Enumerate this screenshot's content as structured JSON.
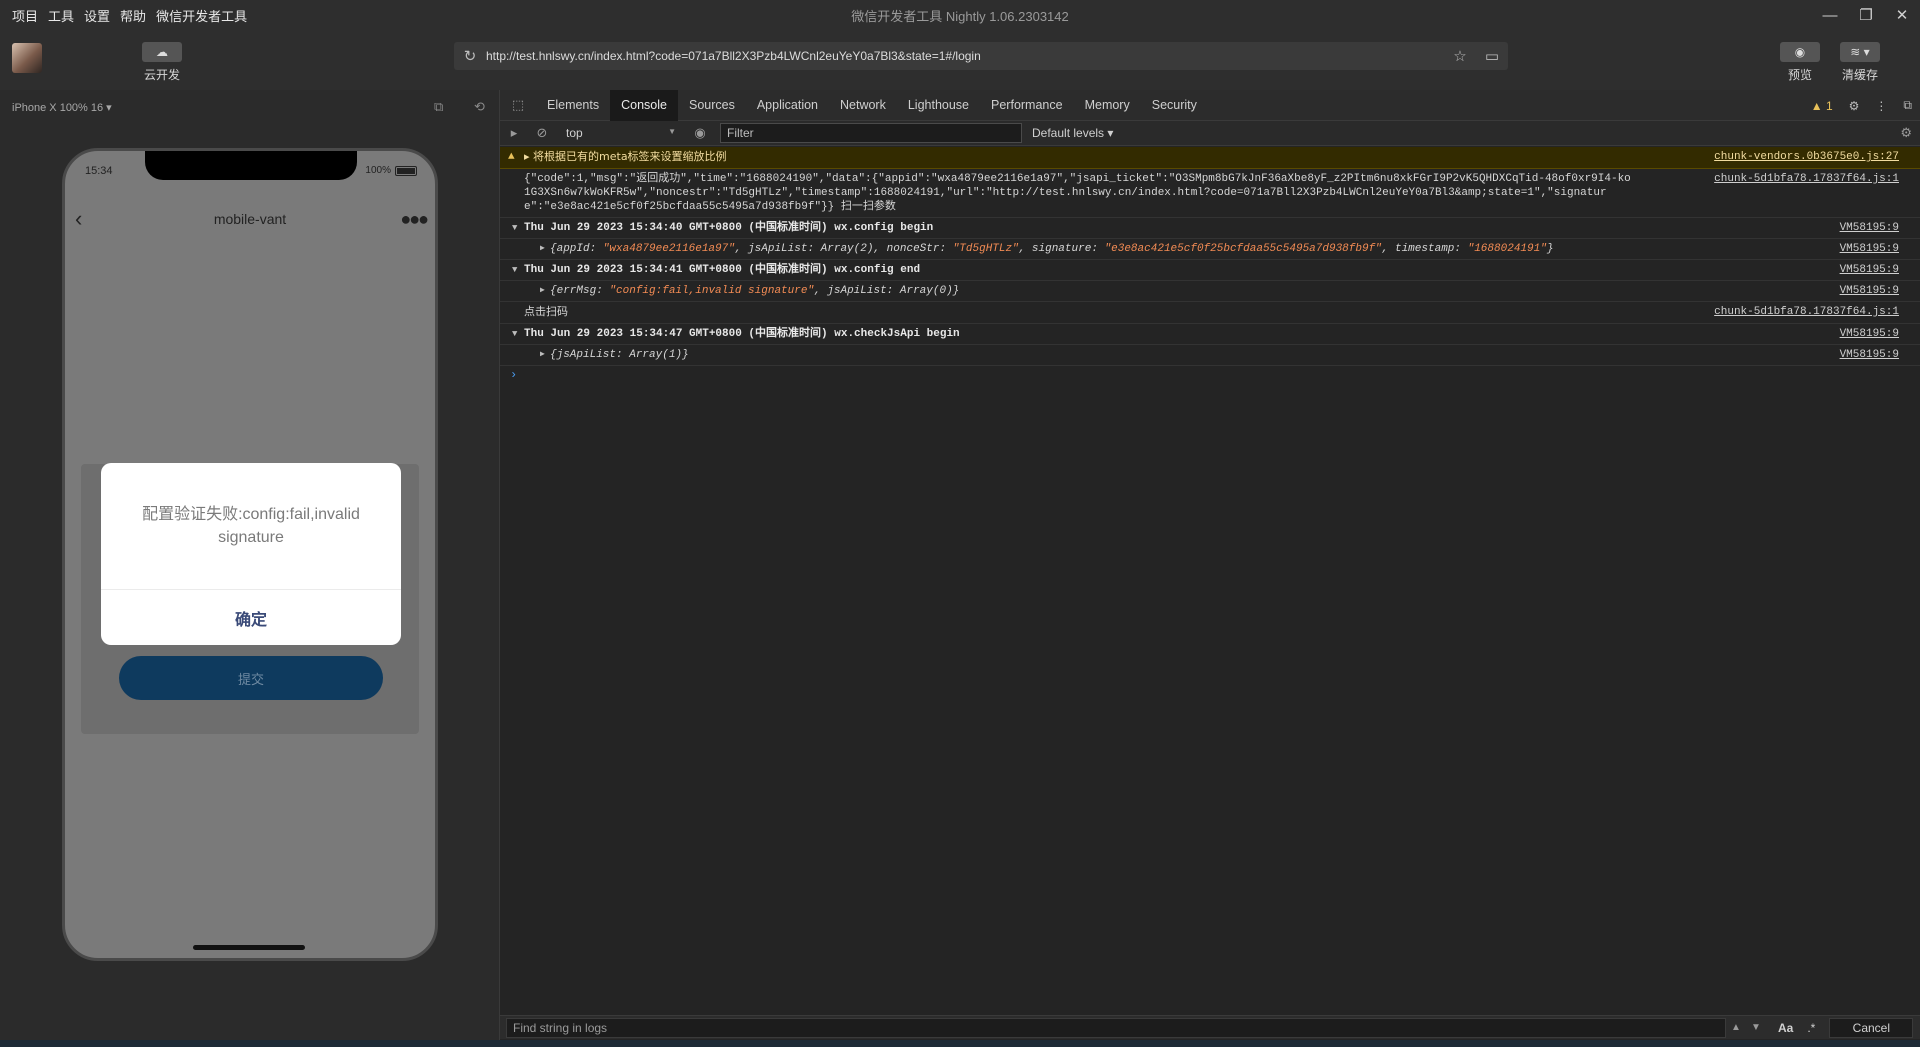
{
  "titlebar": {
    "menu": [
      "项目",
      "工具",
      "设置",
      "帮助",
      "微信开发者工具"
    ],
    "title": "微信开发者工具 Nightly 1.06.2303142"
  },
  "toolbar": {
    "cloud_label": "云开发",
    "url": "http://test.hnlswy.cn/index.html?code=071a7Bll2X3Pzb4LWCnl2euYeY0a7Bl3&state=1#/login",
    "preview_label": "预览",
    "clear_cache_label": "清缓存"
  },
  "simulator": {
    "device": "iPhone X 100% 16 ▾",
    "status_time": "15:34",
    "battery": "100%",
    "nav_title": "mobile-vant",
    "dialog_message": "配置验证失败:config:fail,invalid signature",
    "dialog_confirm": "确定",
    "submit_label": "提交"
  },
  "devtools": {
    "tabs": [
      "Elements",
      "Console",
      "Sources",
      "Application",
      "Network",
      "Lighthouse",
      "Performance",
      "Memory",
      "Security"
    ],
    "active_tab": "Console",
    "warning_count": "1",
    "context": "top",
    "filter_placeholder": "Filter",
    "levels": "Default levels ▾",
    "logs": [
      {
        "kind": "warn",
        "text": "▸ 将根据已有的meta标签来设置缩放比例",
        "src": "chunk-vendors.0b3675e0.js:27"
      },
      {
        "kind": "plain",
        "text": "{\"code\":1,\"msg\":\"返回成功\",\"time\":\"1688024190\",\"data\":{\"appid\":\"wxa4879ee2116e1a97\",\"jsapi_ticket\":\"O3SMpm8bG7kJnF36aXbe8yF_z2PItm6nu8xkFGrI9P2vK5QHDXCqTid-48of0xr9I4-ko1G3XSn6w7kWoKFR5w\",\"noncestr\":\"Td5gHTLz\",\"timestamp\":1688024191,\"url\":\"http://test.hnlswy.cn/index.html?code=071a7Bll2X3Pzb4LWCnl2euYeY0a7Bl3&amp;state=1\",\"signature\":\"e3e8ac421e5cf0f25bcfdaa55c5495a7d938fb9f\"}} 扫一扫参数",
        "src": "chunk-5d1bfa78.17837f64.js:1"
      },
      {
        "kind": "group",
        "text": "Thu Jun 29 2023 15:34:40 GMT+0800 (中国标准时间) wx.config begin",
        "src": "VM58195:9"
      },
      {
        "kind": "obj",
        "pre": "{appId: ",
        "s1": "\"wxa4879ee2116e1a97\"",
        "mid1": ", jsApiList: Array(2), nonceStr: ",
        "s2": "\"Td5gHTLz\"",
        "mid2": ", signature: ",
        "s3": "\"e3e8ac421e5cf0f25bcfdaa55c5495a7d938fb9f\"",
        "mid3": ", timestamp: ",
        "s4": "\"1688024191\"",
        "post": "}",
        "src": "VM58195:9"
      },
      {
        "kind": "group",
        "text": "Thu Jun 29 2023 15:34:41 GMT+0800 (中国标准时间) wx.config end",
        "src": "VM58195:9"
      },
      {
        "kind": "obj2",
        "pre": "{errMsg: ",
        "s1": "\"config:fail,invalid signature\"",
        "post": ", jsApiList: Array(0)}",
        "src": "VM58195:9"
      },
      {
        "kind": "plain",
        "text": "点击扫码",
        "src": "chunk-5d1bfa78.17837f64.js:1"
      },
      {
        "kind": "group",
        "text": "Thu Jun 29 2023 15:34:47 GMT+0800 (中国标准时间) wx.checkJsApi begin",
        "src": "VM58195:9"
      },
      {
        "kind": "obj3",
        "text": "{jsApiList: Array(1)}",
        "src": "VM58195:9"
      }
    ],
    "find_placeholder": "Find string in logs",
    "find_aa": "Aa",
    "find_regex": ".*",
    "find_cancel": "Cancel"
  }
}
